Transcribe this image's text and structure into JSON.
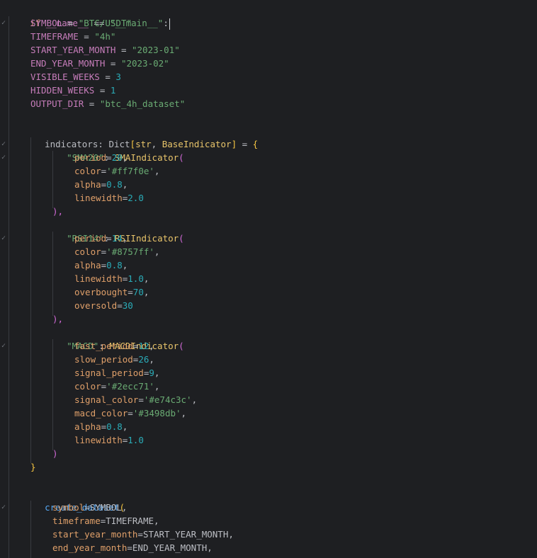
{
  "code": {
    "l1": {
      "if": "if",
      "name": "__name__",
      "eq": "==",
      "main": "\"__main__\"",
      "colon": ":"
    },
    "symbol": {
      "var": "SYMBOL",
      "eq": " = ",
      "val": "\"BTC/USDT\""
    },
    "timeframe": {
      "var": "TIMEFRAME",
      "eq": " = ",
      "val": "\"4h\""
    },
    "start": {
      "var": "START_YEAR_MONTH",
      "eq": " = ",
      "val": "\"2023-01\""
    },
    "end": {
      "var": "END_YEAR_MONTH",
      "eq": " = ",
      "val": "\"2023-02\""
    },
    "visible": {
      "var": "VISIBLE_WEEKS",
      "eq": " = ",
      "val": "3"
    },
    "hidden": {
      "var": "HIDDEN_WEEKS",
      "eq": " = ",
      "val": "1"
    },
    "output": {
      "var": "OUTPUT_DIR",
      "eq": " = ",
      "val": "\"btc_4h_dataset\""
    },
    "indicators": {
      "name": "indicators",
      "colon": ": ",
      "type": "Dict",
      "lb": "[",
      "str": "str",
      "comma": ", ",
      "base": "BaseIndicator",
      "rb": "]",
      "eq": " = ",
      "brace": "{"
    },
    "sma": {
      "key": "\"SMA20\"",
      "colon": ": ",
      "cls": "SMAIndicator",
      "paren": "(",
      "args": [
        {
          "k": "period",
          "v": "20",
          "tail": ","
        },
        {
          "k": "color",
          "v": "'#ff7f0e'",
          "tail": ","
        },
        {
          "k": "alpha",
          "v": "0.8",
          "tail": ","
        },
        {
          "k": "linewidth",
          "v": "2.0",
          "tail": ""
        }
      ],
      "close": "),"
    },
    "rsi": {
      "key": "\"RSI14\"",
      "colon": ": ",
      "cls": "RSIIndicator",
      "paren": "(",
      "args": [
        {
          "k": "period",
          "v": "14",
          "tail": ","
        },
        {
          "k": "color",
          "v": "'#8757ff'",
          "tail": ","
        },
        {
          "k": "alpha",
          "v": "0.8",
          "tail": ","
        },
        {
          "k": "linewidth",
          "v": "1.0",
          "tail": ","
        },
        {
          "k": "overbought",
          "v": "70",
          "tail": ","
        },
        {
          "k": "oversold",
          "v": "30",
          "tail": ""
        }
      ],
      "close": "),"
    },
    "macd": {
      "key": "\"MACD\"",
      "colon": ": ",
      "cls": "MACDIndicator",
      "paren": "(",
      "args": [
        {
          "k": "fast_period",
          "v": "12",
          "tail": ","
        },
        {
          "k": "slow_period",
          "v": "26",
          "tail": ","
        },
        {
          "k": "signal_period",
          "v": "9",
          "tail": ","
        },
        {
          "k": "color",
          "v": "'#2ecc71'",
          "tail": ","
        },
        {
          "k": "signal_color",
          "v": "'#e74c3c'",
          "tail": ","
        },
        {
          "k": "macd_color",
          "v": "'#3498db'",
          "tail": ","
        },
        {
          "k": "alpha",
          "v": "0.8",
          "tail": ","
        },
        {
          "k": "linewidth",
          "v": "1.0",
          "tail": ""
        }
      ],
      "close": ")"
    },
    "dict_close": "}",
    "create": {
      "fn": "create_dataset",
      "paren": "(",
      "args": [
        {
          "k": "symbol",
          "v": "SYMBOL",
          "tail": ","
        },
        {
          "k": "timeframe",
          "v": "TIMEFRAME",
          "tail": ","
        },
        {
          "k": "start_year_month",
          "v": "START_YEAR_MONTH",
          "tail": ","
        },
        {
          "k": "end_year_month",
          "v": "END_YEAR_MONTH",
          "tail": ","
        }
      ]
    }
  }
}
